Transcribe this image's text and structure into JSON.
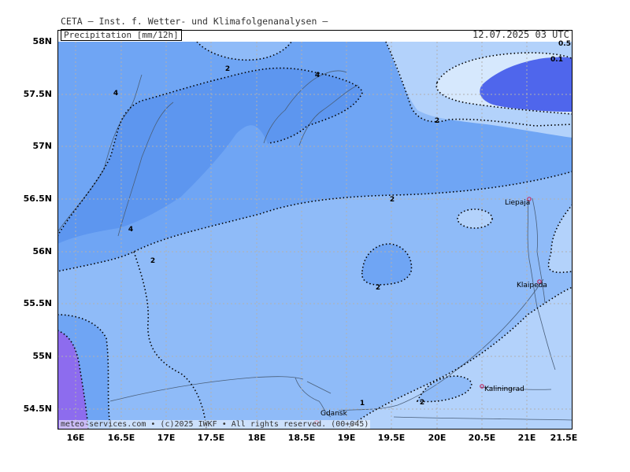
{
  "header": {
    "source": "CETA — Inst. f. Wetter- und Klimafolgenanalysen —",
    "parameter": "Precipitation  [mm/12h]",
    "valid": "12.07.2025 03 UTC"
  },
  "footer": {
    "credit": "meteo-services.com • (c)2025 IWKF • All rights reserved. (00+045)"
  },
  "axes": {
    "lat_labels": [
      "58N",
      "57.5N",
      "57N",
      "56.5N",
      "56N",
      "55.5N",
      "55N",
      "54.5N"
    ],
    "lon_labels": [
      "16E",
      "16.5E",
      "17E",
      "17.5E",
      "18E",
      "18.5E",
      "19E",
      "19.5E",
      "20E",
      "20.5E",
      "21E",
      "21.5E"
    ]
  },
  "cities": [
    "Liepaja",
    "Klaipeda",
    "Kaliningrad",
    "Gdansk"
  ],
  "contour_labels": [
    "2",
    "4",
    "4",
    "2",
    "2",
    "4",
    "2",
    "2",
    "2",
    "0.5",
    "0.1",
    "1",
    "2"
  ],
  "colors": {
    "level_2_4": "#8fbbf8",
    "level_4_plus": "#6fa5f4",
    "level_1_2": "#b3d2fb",
    "level_0_5_1": "#d6e8fd",
    "level_0_1": "#4f66ec",
    "level_high": "#8d6cee",
    "contour": "#000000",
    "coast": "#4a5f7a"
  }
}
